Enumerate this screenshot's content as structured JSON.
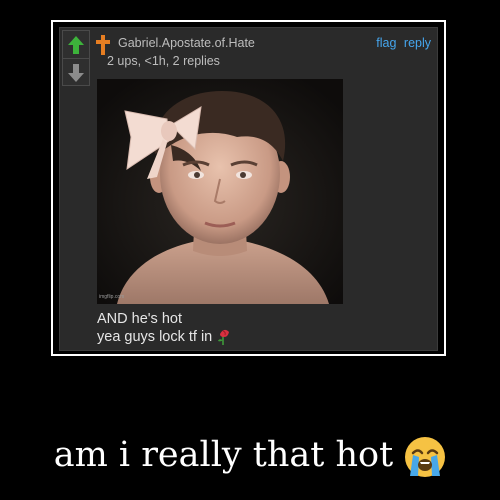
{
  "comment": {
    "username": "Gabriel.Apostate.of.Hate",
    "meta": "2 ups, <1h, 2 replies",
    "actions": {
      "flag_label": "flag",
      "reply_label": "reply"
    },
    "image_watermark": "imgflip.com",
    "body_lines": [
      "AND he's hot",
      "yea guys lock tf in"
    ],
    "body_emoji": "rose-emoji",
    "icons": {
      "upvote": "arrow-up-icon",
      "downvote": "arrow-down-icon",
      "user_flair": "cross-icon"
    }
  },
  "caption": {
    "text": "am i really that hot",
    "emoji": "loudly-crying-face-emoji"
  },
  "colors": {
    "background": "#000000",
    "frame_border": "#ffffff",
    "comment_bg": "#2a2a2a",
    "upvote_active": "#3db33b",
    "flair_cross": "#e67e22",
    "link": "#45a6ee",
    "text_muted": "#bdbdbd",
    "text_body": "#e6e6e6"
  }
}
